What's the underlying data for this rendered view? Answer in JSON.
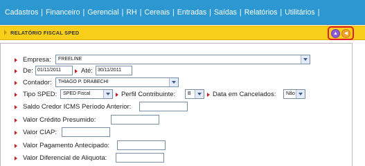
{
  "menu": {
    "items": [
      "Cadastros",
      "Financeiro",
      "Gerencial",
      "RH",
      "Cereais",
      "Entradas",
      "Saídas",
      "Relatórios",
      "Utilitários"
    ],
    "separator": "|"
  },
  "titlebar": {
    "title": "RELATÓRIO FISCAL SPED"
  },
  "nav": {
    "up_icon": "arrow-up-icon",
    "back_icon": "arrow-back-icon"
  },
  "form": {
    "empresa": {
      "label": "Empresa:",
      "value": "FREELINE"
    },
    "de": {
      "label": "De:",
      "value": "01/11/2011"
    },
    "ate": {
      "label": "Até:",
      "value": "30/11/2011"
    },
    "contador": {
      "label": "Contador:",
      "value": "THIAGO P. DRABECHI"
    },
    "tipo_sped": {
      "label": "Tipo SPED:",
      "value": "SPED Fiscal"
    },
    "perfil": {
      "label": "Perfil Contribuinte:",
      "value": "B"
    },
    "data_cancelados": {
      "label": "Data em Cancelados:",
      "value": "Não"
    },
    "saldo_credor": {
      "label": "Saldo Credor ICMS Período Anterior:",
      "value": ""
    },
    "valor_credito": {
      "label": "Valor Crédito Presumido:",
      "value": ""
    },
    "valor_ciap": {
      "label": "Valor CIAP:",
      "value": ""
    },
    "valor_pagamento": {
      "label": "Valor Pagamento Antecipado:",
      "value": ""
    },
    "valor_diferencial": {
      "label": "Valor Diferencial de Aliquota:",
      "value": ""
    }
  },
  "colors": {
    "menu_bar": "#2c97d0",
    "title_bar": "#f7cf1b",
    "highlight": "#e01e2a",
    "bullet": "#c41e1e"
  }
}
